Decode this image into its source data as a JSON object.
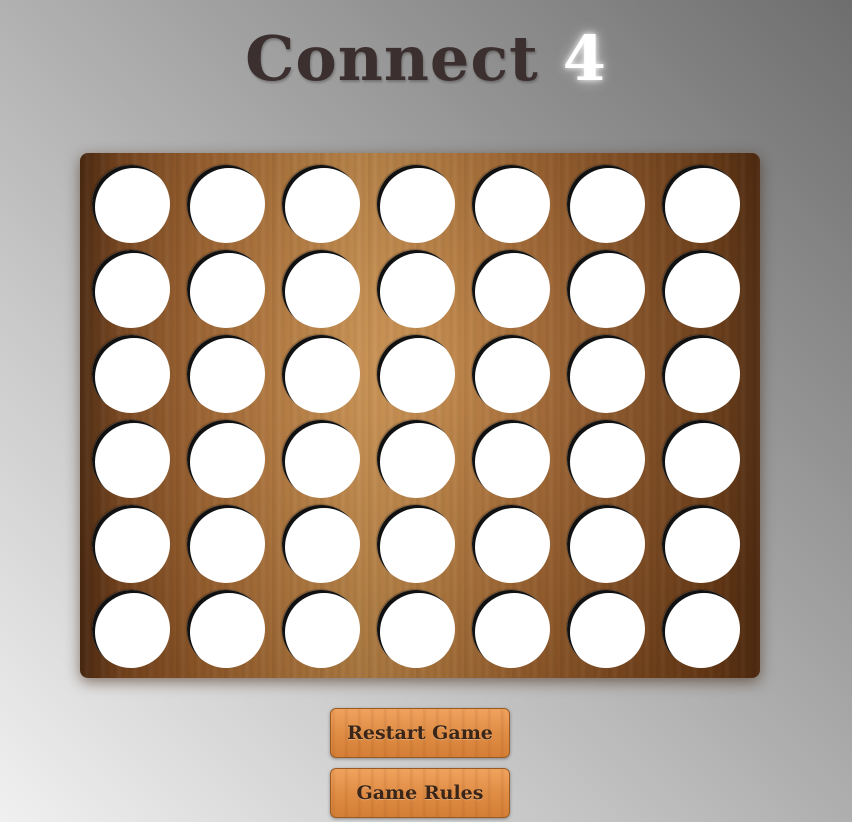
{
  "title": {
    "word": "Connect",
    "number": "4"
  },
  "board": {
    "rows": 6,
    "columns": 7,
    "slot_color": "#ffffff",
    "slots": [
      [
        "empty",
        "empty",
        "empty",
        "empty",
        "empty",
        "empty",
        "empty"
      ],
      [
        "empty",
        "empty",
        "empty",
        "empty",
        "empty",
        "empty",
        "empty"
      ],
      [
        "empty",
        "empty",
        "empty",
        "empty",
        "empty",
        "empty",
        "empty"
      ],
      [
        "empty",
        "empty",
        "empty",
        "empty",
        "empty",
        "empty",
        "empty"
      ],
      [
        "empty",
        "empty",
        "empty",
        "empty",
        "empty",
        "empty",
        "empty"
      ],
      [
        "empty",
        "empty",
        "empty",
        "empty",
        "empty",
        "empty",
        "empty"
      ]
    ]
  },
  "buttons": {
    "restart_label": "Restart Game",
    "rules_label": "Game Rules"
  },
  "colors": {
    "title_text": "#3b2f2f",
    "title_number": "#ffffff",
    "board_wood": "#b97a3c",
    "button_wood": "#e08d45"
  }
}
